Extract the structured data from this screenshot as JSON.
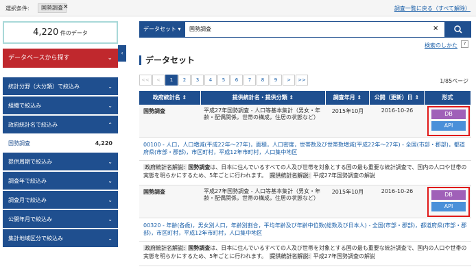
{
  "topbar": {
    "cond_label": "選択条件:",
    "chip_label": "国勢調査",
    "chip_close": "×",
    "back_link": "調査一覧に戻る（すべて解除）"
  },
  "sidebar": {
    "count_value": "4,220",
    "count_unit": "件のデータ",
    "db_search_label": "データベースから探す",
    "collapse_glyph": "‹",
    "nav": [
      {
        "label": "統計分野（大分類）で絞込み"
      },
      {
        "label": "組織で絞込み"
      },
      {
        "label": "政府統計名で絞込み"
      },
      {
        "label": "提供周期で絞込み"
      },
      {
        "label": "調査年で絞込み"
      },
      {
        "label": "調査月で絞込み"
      },
      {
        "label": "公開年月で絞込み"
      },
      {
        "label": "集計地域区分で絞込み"
      }
    ],
    "selected_sub": {
      "label": "国勢調査",
      "count": "4,220"
    },
    "chevron": "⌄"
  },
  "search": {
    "select_label": "データセット ▾",
    "value": "国勢調査",
    "clear": "×",
    "help_link": "検索のしかた",
    "help_icon": "?"
  },
  "section_title": "データセット",
  "pager": {
    "buttons": [
      "<<",
      "<",
      "1",
      "2",
      "3",
      "4",
      "5",
      "6",
      "7",
      "8",
      "9",
      ">",
      ">>"
    ],
    "info": "1/85ページ"
  },
  "table": {
    "headers": [
      "政府統計名 ⇕",
      "提供統計名・提供分類 ⇕",
      "調査年月 ⇕",
      "公開（更新）日 ⇕",
      "形式"
    ],
    "rows": [
      {
        "survey": "国勢調査",
        "title": "平成27年国勢調査 - 人口等基本集計（男女・年齢・配偶関係，世帯の構成，住居の状態など）",
        "survey_month": "2015年10月",
        "published": "2016-10-26",
        "fmt_db": "DB",
        "fmt_api": "API",
        "link": "00100 - 人口，人口増減(平成22年～27年)，面積，人口密度，世帯数及び世帯数増減(平成22年～27年) - 全国(市部・郡部)，都道府県(市部・郡部)，市区町村，平成12年市町村，人口集中地区",
        "desc_label": "政府統計名解説:",
        "desc_name": "国勢調査",
        "desc_text": "は、日本に住んでいるすべての人及び世帯を対象とする国の最も重要な統計調査で、国内の人口や世帯の実態を明らかにするため、5年ごとに行われます。",
        "prov_label": "提供統計名解説:",
        "prov_text": "平成27年国勢調査の解説"
      },
      {
        "survey": "国勢調査",
        "title": "平成27年国勢調査 - 人口等基本集計（男女・年齢・配偶関係，世帯の構成，住居の状態など）",
        "survey_month": "2015年10月",
        "published": "2016-10-26",
        "fmt_db": "DB",
        "fmt_api": "API",
        "link": "00320 - 年齢(各歳)，男女別人口，年齢別割合，平均年齢及び年齢中位数(総数及び日本人) - 全国(市部・郡部)，都道府県(市部・郡部)，市区町村，平成12年市町村，人口集中地区",
        "desc_label": "政府統計名解説:",
        "desc_name": "国勢調査",
        "desc_text": "は、日本に住んでいるすべての人及び世帯を対象とする国の最も重要な統計調査で、国内の人口や世帯の実態を明らかにするため、5年ごとに行われます。",
        "prov_label": "提供統計名解説:",
        "prov_text": "平成27年国勢調査の解説"
      }
    ]
  }
}
